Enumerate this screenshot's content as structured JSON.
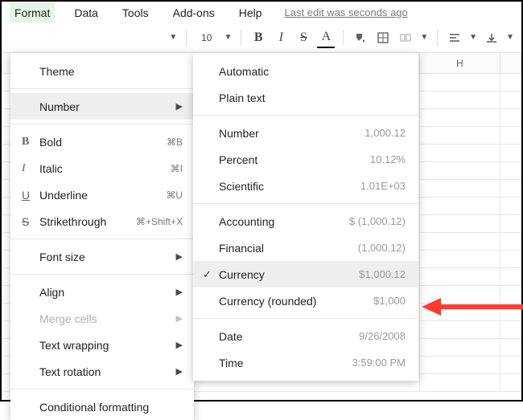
{
  "menubar": {
    "format": "Format",
    "data": "Data",
    "tools": "Tools",
    "addons": "Add-ons",
    "help": "Help",
    "lastedit": "Last edit was seconds ago"
  },
  "toolbar": {
    "fontsize": "10"
  },
  "columns": {
    "h": "H"
  },
  "formatMenu": {
    "theme": "Theme",
    "number": "Number",
    "bold": "Bold",
    "bold_sc": "⌘B",
    "italic": "Italic",
    "italic_sc": "⌘I",
    "underline": "Underline",
    "underline_sc": "⌘U",
    "strike": "Strikethrough",
    "strike_sc": "⌘+Shift+X",
    "fontsize": "Font size",
    "align": "Align",
    "merge": "Merge cells",
    "wrapping": "Text wrapping",
    "rotation": "Text rotation",
    "condformat": "Conditional formatting"
  },
  "numberMenu": {
    "automatic": "Automatic",
    "plaintext": "Plain text",
    "number": "Number",
    "number_s": "1,000.12",
    "percent": "Percent",
    "percent_s": "10.12%",
    "scientific": "Scientific",
    "scientific_s": "1.01E+03",
    "accounting": "Accounting",
    "accounting_s": "$ (1,000.12)",
    "financial": "Financial",
    "financial_s": "(1,000.12)",
    "currency": "Currency",
    "currency_s": "$1,000.12",
    "currency_rounded": "Currency (rounded)",
    "currency_rounded_s": "$1,000",
    "date": "Date",
    "date_s": "9/26/2008",
    "time": "Time",
    "time_s": "3:59:00 PM"
  }
}
